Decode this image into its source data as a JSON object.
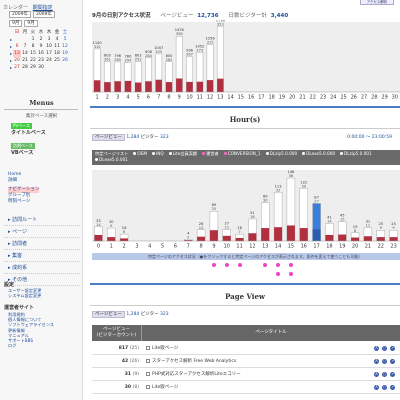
{
  "sidebar": {
    "calendar_tab": "カレンダー",
    "period_tab": "期間指定",
    "year_select": "2009年",
    "month_select": "9月",
    "year_select2": "2009年",
    "month_select2": "9月",
    "weekdays": [
      "日",
      "月",
      "火",
      "水",
      "木",
      "金",
      "土"
    ],
    "weeks": [
      [
        "",
        "",
        "1",
        "2",
        "3",
        "4",
        "5"
      ],
      [
        "6",
        "7",
        "8",
        "9",
        "10",
        "11",
        "12"
      ],
      [
        "13",
        "14",
        "15",
        "16",
        "17",
        "18",
        "19"
      ],
      [
        "20",
        "21",
        "22",
        "23",
        "24",
        "25",
        "26"
      ],
      [
        "27",
        "28",
        "29",
        "30",
        "",
        "",
        ""
      ]
    ],
    "menus_title": "Menus",
    "aggregation_label": "集計ベース選択",
    "pv_tag": "PVベース",
    "pv_base": "タイトルベース",
    "vis_tag": "訪問ベース",
    "vis_base": "VBベース",
    "view_list": [
      "Home",
      "詳細",
      "ナビゲーション",
      "グループ別",
      "時刻ページ"
    ],
    "nav_items": [
      "訪問ルート",
      "ページ",
      "訪問者",
      "集客",
      "成約系",
      "その他"
    ],
    "settings_title": "設定",
    "settings_list": [
      "ユーザー設定変更",
      "システム設定変更"
    ],
    "support_title": "運営者サイト",
    "support_list": [
      "利用規約",
      "個人情報について",
      "ソフトウェアライセンス",
      "更新情報",
      "マニュアル",
      "サポートBBS",
      "ログ"
    ]
  },
  "main": {
    "top_button": "アクセス解析",
    "monthly_title": "9月の日別アクセス状況",
    "pv_label": "ページビュー",
    "pv_total": "12,736",
    "visitors_label": "日数ビジター計",
    "visitors_total": "3,440",
    "hour_title": "Hour(s)",
    "pv_chip": "ページビュー",
    "hour_pv": "1,284",
    "hour_visitors_label": "ビジター",
    "hour_visitors": "323",
    "range": "0:00:00 〜 23:00:59",
    "filters": [
      "特定ページリスト",
      "OEM",
      "INQ",
      "Lite会員実績",
      "運営者",
      "CONVERSION_1",
      "DLzip5.0.000",
      "DLexe5.0.000",
      "DLzip5.0.001",
      "DLexe5.0.001"
    ],
    "note": "特定ページのアクセス状況（●をクリックすると特定ページのアクセスが表示されます。条件を変えて使うことも可能）",
    "pageview_title": "Page View",
    "table_col1": "ページビュー",
    "table_col1b": "(ビジターカウント)",
    "table_col2": "ページタイトル",
    "rows": [
      {
        "count": "817",
        "pct": "(25)",
        "title": "Lite版ページ"
      },
      {
        "count": "42",
        "pct": "(26)",
        "title": "スターアクセス解析 Free Web Analytics"
      },
      {
        "count": "31",
        "pct": "(9)",
        "title": "PHP式対応スターアクセス解析Liteエコリー"
      },
      {
        "count": "30",
        "pct": "(8)",
        "title": "Lite版ページ"
      }
    ]
  },
  "chart_data": [
    {
      "type": "bar",
      "title": "9月の日別アクセス状況",
      "categories": [
        "1",
        "2",
        "3",
        "4",
        "5",
        "6",
        "7",
        "8",
        "9",
        "10",
        "11",
        "12",
        "13",
        "14",
        "15",
        "16",
        "17",
        "18",
        "19",
        "20",
        "21",
        "22",
        "23",
        "24",
        "25",
        "26",
        "27",
        "28",
        "29",
        "30"
      ],
      "series": [
        {
          "name": "ページビュー",
          "values": [
            1140,
            803,
            796,
            780,
            802,
            906,
            1007,
            800,
            1476,
            936,
            1052,
            1256,
            1736,
            0,
            0,
            0,
            0,
            0,
            0,
            0,
            0,
            0,
            0,
            0,
            0,
            0,
            0,
            0,
            0,
            0
          ]
        },
        {
          "name": "ビジター",
          "values": [
            310,
            261,
            285,
            294,
            252,
            284,
            325,
            262,
            358,
            267,
            273,
            315,
            353,
            0,
            0,
            0,
            0,
            0,
            0,
            0,
            0,
            0,
            0,
            0,
            0,
            0,
            0,
            0,
            0,
            0
          ]
        }
      ],
      "ylim": [
        0,
        1800
      ],
      "grid": false,
      "legend": "none"
    },
    {
      "type": "bar",
      "title": "Hour(s)",
      "categories": [
        "0",
        "1",
        "2",
        "3",
        "4",
        "5",
        "6",
        "7",
        "8",
        "9",
        "10",
        "11",
        "12",
        "13",
        "14",
        "15",
        "16",
        "17",
        "18",
        "19",
        "20",
        "21",
        "22",
        "23"
      ],
      "series": [
        {
          "name": "ページビュー",
          "values": [
            33,
            30,
            16,
            0,
            0,
            0,
            0,
            4,
            26,
            69,
            27,
            16,
            51,
            89,
            113,
            146,
            122,
            87,
            41,
            45,
            19,
            31,
            25,
            25
          ]
        },
        {
          "name": "ビジター",
          "values": [
            14,
            9,
            6,
            0,
            0,
            0,
            0,
            2,
            10,
            25,
            12,
            7,
            18,
            30,
            32,
            36,
            30,
            27,
            14,
            15,
            8,
            11,
            9,
            9
          ]
        }
      ],
      "highlight_category": "17",
      "ylim": [
        0,
        160
      ],
      "grid": false,
      "legend": "none"
    }
  ]
}
